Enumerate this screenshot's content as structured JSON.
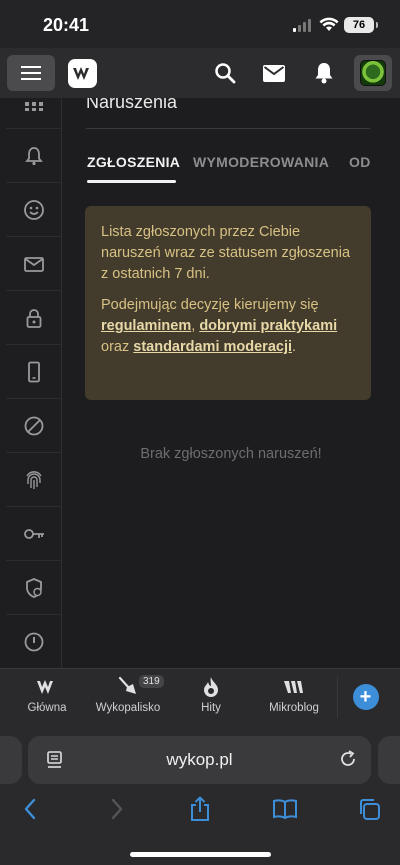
{
  "status": {
    "time": "20:41",
    "battery": "76"
  },
  "main": {
    "title": "Naruszenia",
    "tabs": [
      {
        "label": "ZGŁOSZENIA"
      },
      {
        "label": "WYMODEROWANIA"
      },
      {
        "label": "OD"
      }
    ],
    "notice": {
      "p1": "Lista zgłoszonych przez Ciebie naruszeń wraz ze statusem zgłoszenia z ostatnich 7 dni.",
      "p2_before": "Podejmując decyzję kierujemy się ",
      "link1": "regulaminem",
      "sep1": ", ",
      "link2": "dobrymi praktykami",
      "sep2": " oraz ",
      "link3": "standardami moderacji",
      "end": "."
    },
    "empty": "Brak zgłoszonych naruszeń!"
  },
  "bottomnav": {
    "items": [
      {
        "label": "Główna"
      },
      {
        "label": "Wykopalisko",
        "badge": "319"
      },
      {
        "label": "Hity"
      },
      {
        "label": "Mikroblog"
      }
    ]
  },
  "browser": {
    "url": "wykop.pl"
  }
}
